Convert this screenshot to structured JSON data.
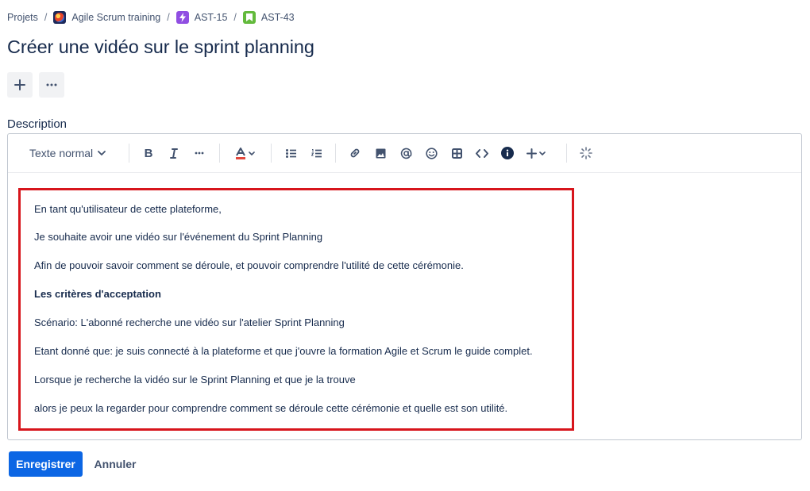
{
  "breadcrumb": {
    "items": [
      {
        "label": "Projets"
      },
      {
        "label": "Agile Scrum training",
        "icon": "project-avatar-icon"
      },
      {
        "label": "AST-15",
        "icon": "epic-lightning-icon"
      },
      {
        "label": "AST-43",
        "icon": "story-bookmark-icon"
      }
    ],
    "separator": "/"
  },
  "issue": {
    "title": "Créer une vidéo sur le sprint planning"
  },
  "quick_actions": {
    "add_icon": "plus-icon",
    "more_icon": "more-horizontal-icon"
  },
  "description": {
    "label": "Description",
    "toolbar": {
      "text_style": "Texte normal",
      "buttons": [
        "bold",
        "italic",
        "more-formatting",
        "text-color",
        "bullet-list",
        "numbered-list",
        "link",
        "image",
        "mention",
        "emoji",
        "table",
        "code",
        "info-panel",
        "insert-more",
        "ai-assist"
      ]
    },
    "paragraphs": [
      {
        "text": "En tant qu'utilisateur de cette plateforme,",
        "bold": false
      },
      {
        "text": "Je souhaite avoir une vidéo sur l'événement du Sprint Planning",
        "bold": false
      },
      {
        "text": "Afin de pouvoir savoir comment se déroule, et pouvoir comprendre l'utilité de cette cérémonie.",
        "bold": false
      },
      {
        "text": "Les critères d'acceptation",
        "bold": true
      },
      {
        "text": "Scénario: L'abonné recherche une vidéo sur l'atelier Sprint Planning",
        "bold": false
      },
      {
        "text": "Etant donné que: je suis connecté à la plateforme et que j'ouvre la formation Agile et Scrum le guide complet.",
        "bold": false
      },
      {
        "text": "Lorsque je recherche la vidéo sur le Sprint Planning et que je la trouve",
        "bold": false
      },
      {
        "text": "alors je peux la regarder pour comprendre comment se déroule cette cérémonie et quelle est son utilité.",
        "bold": false
      }
    ],
    "highlight_color": "#d7151c"
  },
  "actions": {
    "save_label": "Enregistrer",
    "cancel_label": "Annuler",
    "primary_color": "#0c66e4"
  }
}
